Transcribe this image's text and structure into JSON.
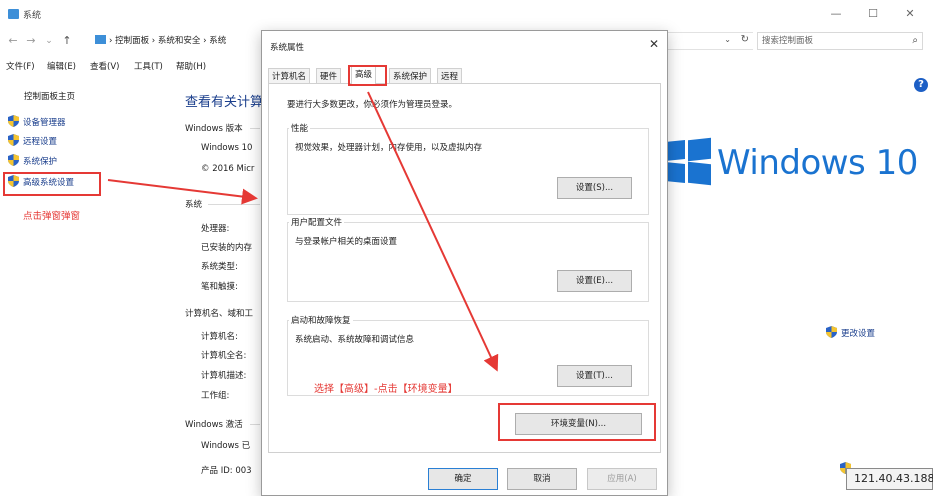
{
  "window": {
    "title": "系统",
    "controls": {
      "minimize": "—",
      "maximize": "☐",
      "close": "✕"
    }
  },
  "nav": {
    "back": "←",
    "forward": "→",
    "dropdown": "⌄",
    "up": "↑",
    "breadcrumb": "› 控制面板 › 系统和安全 › 系统",
    "search_placeholder": "搜索控制面板",
    "refresh": "↻",
    "addr_dropdown": "⌄"
  },
  "menu": {
    "file": "文件(F)",
    "edit": "编辑(E)",
    "view": "查看(V)",
    "tools": "工具(T)",
    "help": "帮助(H)"
  },
  "left_pane": {
    "home": "控制面板主页",
    "items": [
      {
        "label": "设备管理器"
      },
      {
        "label": "远程设置"
      },
      {
        "label": "系统保护"
      },
      {
        "label": "高级系统设置"
      }
    ],
    "note": "点击弹窗弹窗"
  },
  "content": {
    "title": "查看有关计算",
    "windows_edition_head": "Windows 版本",
    "windows_10": "Windows 10",
    "copyright": "© 2016 Micr",
    "system_head": "系统",
    "processor": "处理器:",
    "ram": "已安装的内存",
    "system_type": "系统类型:",
    "pen_touch": "笔和触摸:",
    "computer_head": "计算机名、域和工",
    "computer_name": "计算机名:",
    "full_name": "计算机全名:",
    "description": "计算机描述:",
    "workgroup": "工作组:",
    "activation_head": "Windows 激活",
    "activated": "Windows 已",
    "product_id": "产品 ID: 003",
    "windows_logo_text": "Windows 10",
    "change_settings": "更改设置",
    "ip": "121.40.43.188"
  },
  "dialog": {
    "title": "系统属性",
    "close": "✕",
    "tabs": [
      "计算机名",
      "硬件",
      "高级",
      "系统保护",
      "远程"
    ],
    "active_tab": "高级",
    "admin_note": "要进行大多数更改，你必须作为管理员登录。",
    "performance": {
      "label": "性能",
      "desc": "视觉效果，处理器计划，内存使用，以及虚拟内存",
      "button": "设置(S)..."
    },
    "profiles": {
      "label": "用户配置文件",
      "desc": "与登录帐户相关的桌面设置",
      "button": "设置(E)..."
    },
    "startup": {
      "label": "启动和故障恢复",
      "desc": "系统启动、系统故障和调试信息",
      "button": "设置(T)..."
    },
    "instruction": "选择【高级】-点击【环境变量】",
    "env_button": "环境变量(N)...",
    "ok": "确定",
    "cancel": "取消",
    "apply": "应用(A)"
  },
  "colors": {
    "accent": "#1a73d0",
    "annotation": "#e53935",
    "link": "#1a3e8c"
  }
}
